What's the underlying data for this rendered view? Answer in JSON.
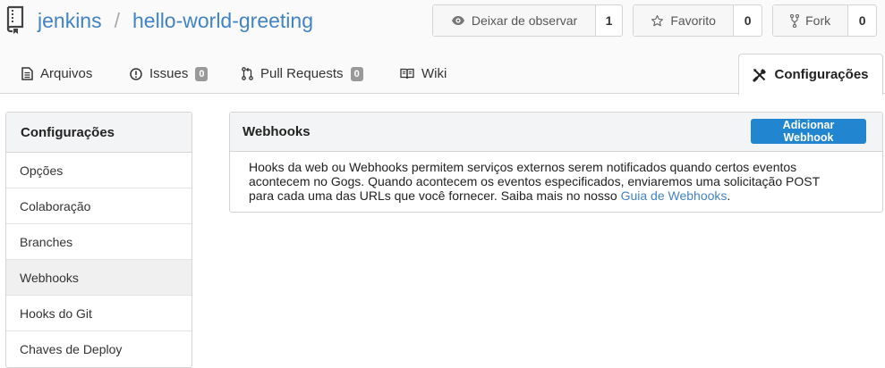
{
  "repo": {
    "owner": "jenkins",
    "separator": "/",
    "name": "hello-world-greeting"
  },
  "actions": {
    "watch": {
      "label": "Deixar de observar",
      "count": "1"
    },
    "star": {
      "label": "Favorito",
      "count": "0"
    },
    "fork": {
      "label": "Fork",
      "count": "0"
    }
  },
  "tabs": {
    "files": {
      "label": "Arquivos"
    },
    "issues": {
      "label": "Issues",
      "count": "0"
    },
    "pulls": {
      "label": "Pull Requests",
      "count": "0"
    },
    "wiki": {
      "label": "Wiki"
    },
    "settings": {
      "label": "Configurações"
    }
  },
  "sidebar": {
    "title": "Configurações",
    "items": [
      {
        "label": "Opções"
      },
      {
        "label": "Colaboração"
      },
      {
        "label": "Branches"
      },
      {
        "label": "Webhooks",
        "active": true
      },
      {
        "label": "Hooks do Git"
      },
      {
        "label": "Chaves de Deploy"
      }
    ]
  },
  "webhooks": {
    "title": "Webhooks",
    "add_button": "Adicionar Webhook",
    "desc_line1": "Hooks da web ou Webhooks permitem serviços externos serem notificados quando certos eventos",
    "desc_line2": "acontecem no Gogs. Quando acontecem os eventos especificados, enviaremos uma solicitação POST",
    "desc_line3_prefix": "para cada uma das URLs que você fornecer. Saiba mais no nosso ",
    "guide_link": "Guia de Webhooks",
    "desc_suffix": "."
  },
  "colors": {
    "link": "#4183c4",
    "primary_button": "#2185d0",
    "badge": "#999999",
    "header_bg": "#fafafa"
  }
}
